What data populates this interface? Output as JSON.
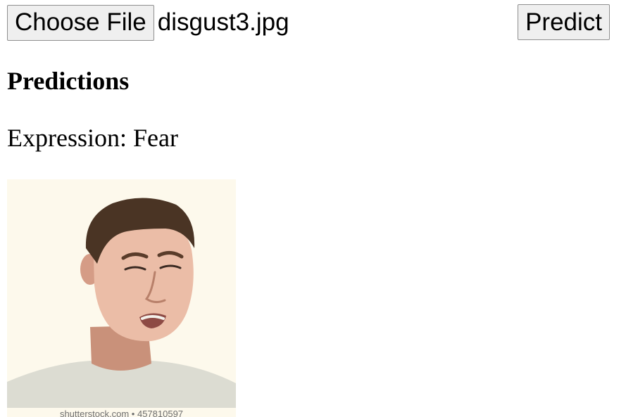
{
  "form": {
    "choose_file_label": "Choose File",
    "file_name": "disgust3.jpg",
    "predict_label": "Predict"
  },
  "results": {
    "heading": "Predictions",
    "expression_text": "Expression: Fear"
  },
  "image": {
    "watermark_text": "shutterstock.com • 457810597"
  }
}
